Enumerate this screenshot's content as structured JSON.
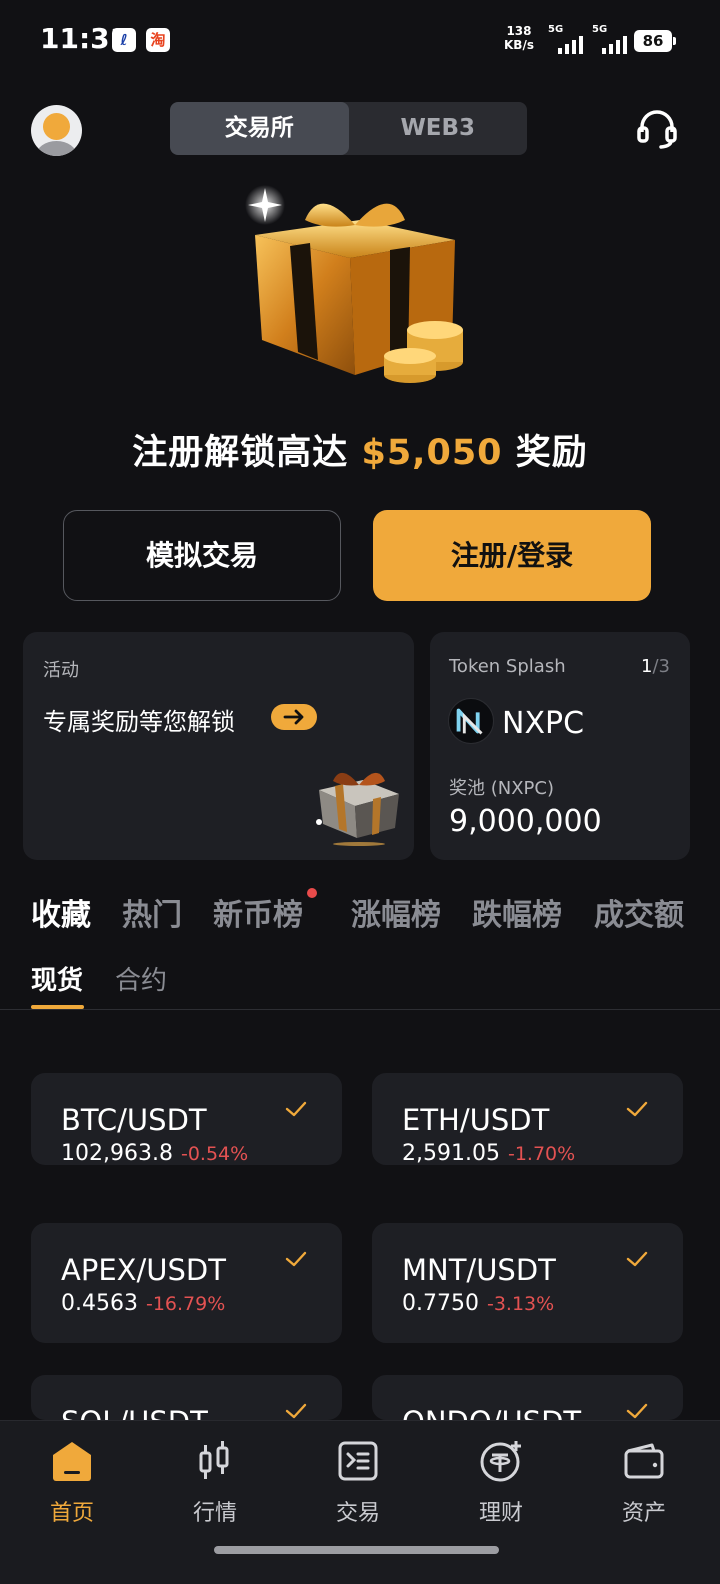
{
  "status_bar": {
    "time": "11:31",
    "app_icon_1": "ℓ",
    "app_icon_2": "淘",
    "net_speed_value": "138",
    "net_speed_unit": "KB/s",
    "sim1_tag": "5G",
    "sim2_tag": "5G",
    "battery": "86"
  },
  "header": {
    "tabs": [
      {
        "label": "交易所",
        "active": true
      },
      {
        "label": "WEB3",
        "active": false
      }
    ],
    "support_icon": "headset-icon",
    "avatar_icon": "user-avatar"
  },
  "hero": {
    "headline_prefix": "注册解锁高达",
    "headline_amount": "$5,050",
    "headline_suffix": "奖励",
    "demo_button": "模拟交易",
    "register_button": "注册/登录"
  },
  "activity_card": {
    "tag": "活动",
    "text": "专属奖励等您解锁",
    "arrow_icon": "arrow-right-icon"
  },
  "token_card": {
    "name": "Token Splash",
    "page_current": "1",
    "page_total": "/3",
    "symbol": "NXPC",
    "pool_label": "奖池 (NXPC)",
    "pool_value": "9,000,000"
  },
  "market_tabs": [
    {
      "label": "收藏",
      "active": true
    },
    {
      "label": "热门",
      "active": false
    },
    {
      "label": "新币榜",
      "active": false,
      "dot": true
    },
    {
      "label": "涨幅榜",
      "active": false
    },
    {
      "label": "跌幅榜",
      "active": false
    },
    {
      "label": "成交额",
      "active": false
    }
  ],
  "sub_tabs": [
    {
      "label": "现货",
      "active": true
    },
    {
      "label": "合约",
      "active": false
    }
  ],
  "watchlist": [
    {
      "symbol": "BTC/USDT",
      "price": "102,963.8",
      "change": "-0.54%"
    },
    {
      "symbol": "ETH/USDT",
      "price": "2,591.05",
      "change": "-1.70%"
    },
    {
      "symbol": "APEX/USDT",
      "price": "0.4563",
      "change": "-16.79%"
    },
    {
      "symbol": "MNT/USDT",
      "price": "0.7750",
      "change": "-3.13%"
    },
    {
      "symbol": "SOL/USDT",
      "price": "",
      "change": ""
    },
    {
      "symbol": "ONDO/USDT",
      "price": "",
      "change": ""
    }
  ],
  "bottom_nav": [
    {
      "label": "首页",
      "icon": "home-icon",
      "active": true
    },
    {
      "label": "行情",
      "icon": "candlestick-icon",
      "active": false
    },
    {
      "label": "交易",
      "icon": "trade-icon",
      "active": false
    },
    {
      "label": "理财",
      "icon": "earn-icon",
      "active": false
    },
    {
      "label": "资产",
      "icon": "wallet-icon",
      "active": false
    }
  ],
  "colors": {
    "accent": "#f0a93b",
    "background": "#111114",
    "card": "#1e1f24",
    "negative": "#e35252"
  }
}
